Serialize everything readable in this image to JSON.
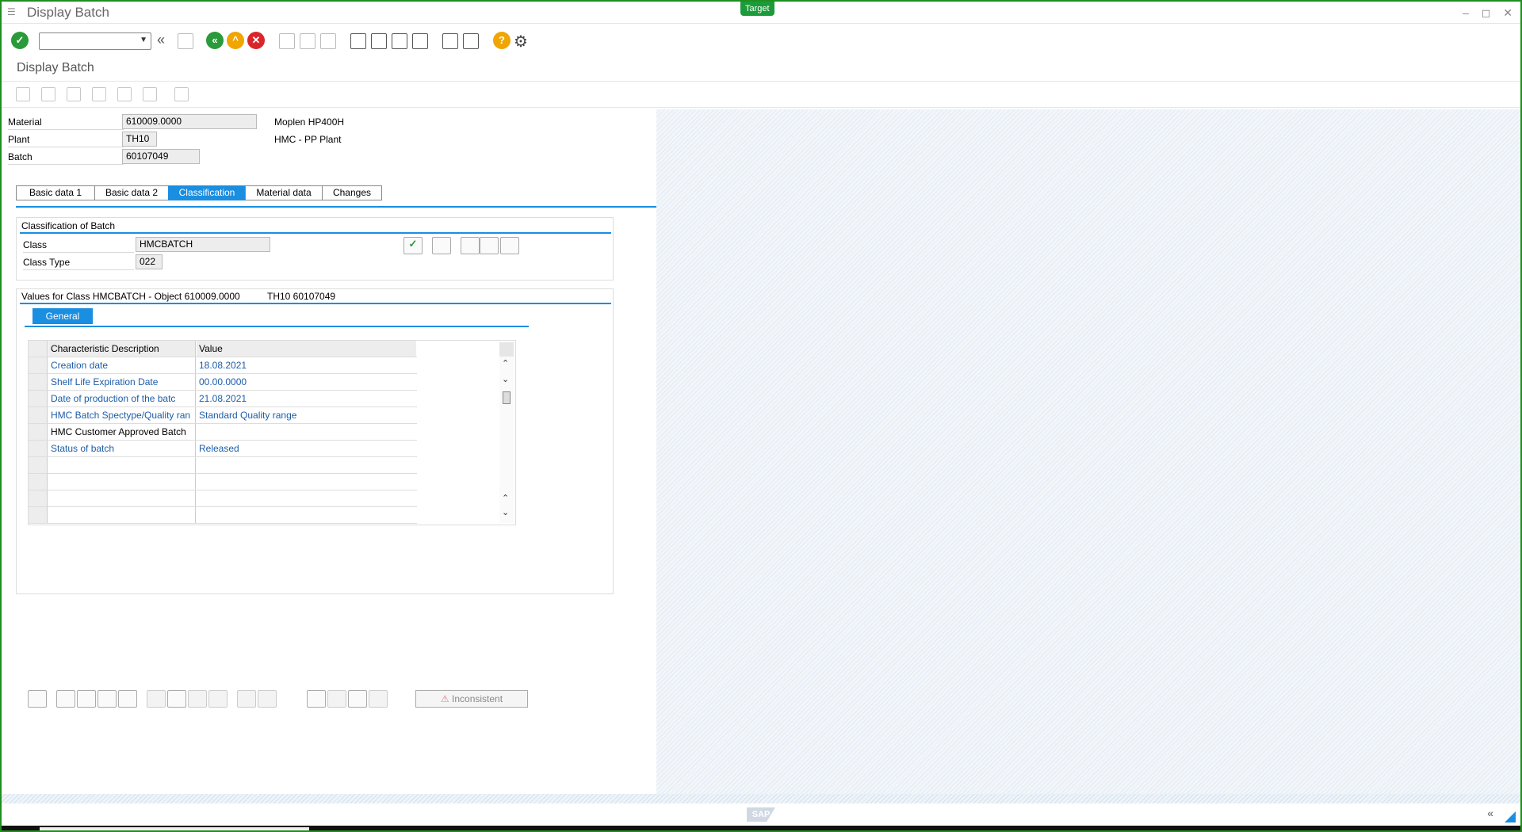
{
  "window": {
    "title": "Display Batch",
    "target_badge": "Target",
    "controls": "–  ◻  ✕"
  },
  "toolbar": {
    "command_value": "",
    "icons": [
      "enter-icon",
      "back-icon",
      "save-icon",
      "exit-icon",
      "up-icon",
      "cancel-icon",
      "print-icon",
      "find-icon",
      "find-next-icon",
      "first-page-icon",
      "previous-page-icon",
      "next-page-icon",
      "last-page-icon",
      "new-session-icon",
      "shortcut-icon",
      "help-icon",
      "settings-icon"
    ]
  },
  "screen": {
    "subtitle": "Display Batch"
  },
  "header": {
    "material_label": "Material",
    "material_value": "610009.0000",
    "material_desc": "Moplen HP400H",
    "plant_label": "Plant",
    "plant_value": "TH10",
    "plant_desc": "HMC - PP Plant",
    "batch_label": "Batch",
    "batch_value": "60107049"
  },
  "tabs": [
    "Basic data 1",
    "Basic data 2",
    "Classification",
    "Material data",
    "Changes"
  ],
  "active_tab": "Classification",
  "classification": {
    "title": "Classification of Batch",
    "class_label": "Class",
    "class_value": "HMCBATCH",
    "class_type_label": "Class Type",
    "class_type_value": "022"
  },
  "values": {
    "title": "Values for Class HMCBATCH - Object 610009.0000",
    "object_suffix": "TH10 60107049",
    "subtab": "General",
    "columns": [
      "Characteristic Description",
      "Value"
    ],
    "rows": [
      {
        "desc": "Creation date",
        "value": "18.08.2021"
      },
      {
        "desc": "Shelf Life Expiration Date",
        "value": "00.00.0000"
      },
      {
        "desc": "Date of production of the batc",
        "value": "21.08.2021"
      },
      {
        "desc": "HMC Batch Spectype/Quality ran",
        "value": "Standard Quality range"
      },
      {
        "desc": "HMC Customer Approved  Batch",
        "value": ""
      },
      {
        "desc": "Status of batch",
        "value": "Released"
      }
    ],
    "inconsistent_label": "Inconsistent"
  },
  "colors": {
    "accent": "#1a8ee0",
    "window_border": "#1f8f1f",
    "link_text": "#1c5da8"
  }
}
